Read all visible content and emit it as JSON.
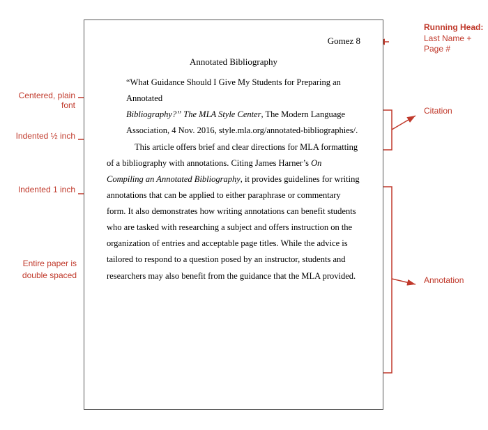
{
  "document": {
    "running_head": "Gomez 8",
    "title": "Annotated Bibliography",
    "citation": {
      "line1": "“What Guidance Should I Give My Students for Preparing an Annotated",
      "line2_italic": "Bibliography?” The MLA Style Center",
      "line2_rest": ", The Modern Language",
      "line3": "Association, 4 Nov. 2016, style.mla.org/annotated-bibliographies/."
    },
    "annotation": "This article offers brief and clear directions for MLA formatting of a bibliography with annotations. Citing James Harner’s On Compiling an Annotated Bibliography, it provides guidelines for writing annotations that can be applied to either paraphrase or commentary form. It also demonstrates how writing annotations can benefit students who are tasked with researching a subject and offers instruction on the organization of entries and acceptable page titles. While the advice is tailored to respond to a question posed by an instructor, students and researchers may also benefit from the guidance that the MLA provided."
  },
  "labels": {
    "centered": "Centered, plain font",
    "indented_half": "Indented ½ inch",
    "indented_1": "Indented 1 inch",
    "double_spaced": "Entire paper is double spaced",
    "running_head_title": "Running Head:",
    "running_head_sub": "Last Name + Page #",
    "citation": "Citation",
    "annotation": "Annotation"
  }
}
